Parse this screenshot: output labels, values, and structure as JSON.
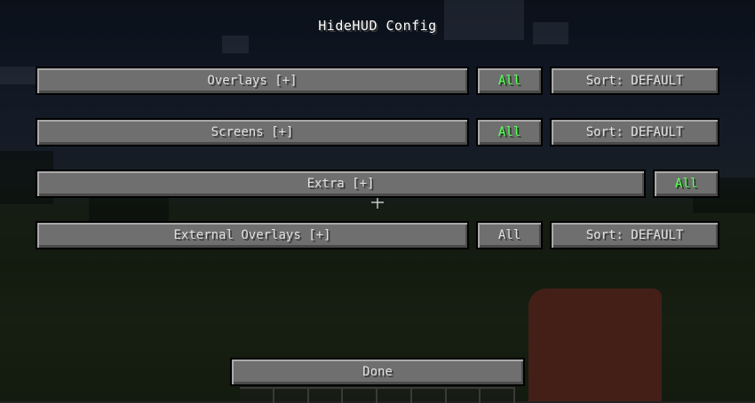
{
  "screen": {
    "title": "HideHUD Config"
  },
  "rows": [
    {
      "label": "Overlays [+]",
      "all_label": "All",
      "all_color": "#55ff55",
      "sort_label": "Sort: DEFAULT"
    },
    {
      "label": "Screens [+]",
      "all_label": "All",
      "all_color": "#55ff55",
      "sort_label": "Sort: DEFAULT"
    },
    {
      "label": "Extra [+]",
      "all_label": "All",
      "all_color": "#55ff55"
    },
    {
      "label": "External Overlays [+]",
      "all_label": "All",
      "all_color": "#e0e0e0",
      "sort_label": "Sort: DEFAULT"
    }
  ],
  "footer": {
    "done_label": "Done"
  }
}
